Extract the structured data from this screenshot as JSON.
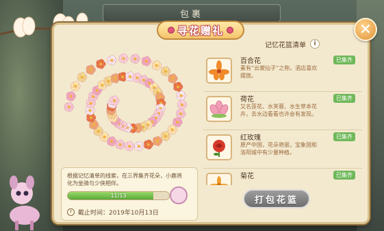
{
  "banner": {
    "title": "包裹"
  },
  "panel": {
    "title": "寻花赠礼",
    "close_label": "✕"
  },
  "info": {
    "text": "根据记忆清单的线索，在三界集齐花朵，小鹿将化为坐骑与少侠相伴。",
    "progress_text": "11/13",
    "progress_value": 0.846,
    "deadline": "截止时间：2019年10月13日"
  },
  "list": {
    "header": "记忆花篮清单",
    "info_icon": "i",
    "items": [
      {
        "name": "百合花",
        "desc": "素有“云裳仙子”之称。酒店喜欢摆放。",
        "status": "已集齐",
        "color": "#f08a2a",
        "icon": "lily-icon"
      },
      {
        "name": "荷花",
        "desc": "又名莲花、水芙蓉、水生草本花卉，去水边看看也许会有发现。",
        "status": "已集齐",
        "color": "#f2a0b8",
        "icon": "lotus-icon"
      },
      {
        "name": "红玫瑰",
        "desc": "原产中国，花朵艳丽，宝象国和洛阳城中有少量种植。",
        "status": "已集齐",
        "color": "#d63a2a",
        "icon": "rose-icon"
      },
      {
        "name": "菊花",
        "desc": "",
        "status": "已集齐",
        "color": "#f0a030",
        "icon": "chrysanthemum-icon"
      }
    ]
  },
  "pack_button": {
    "label": "打包花篮"
  },
  "colors": {
    "accent": "#6fb85a",
    "panel": "#f3e9cf",
    "title_outline": "#c24b52"
  }
}
